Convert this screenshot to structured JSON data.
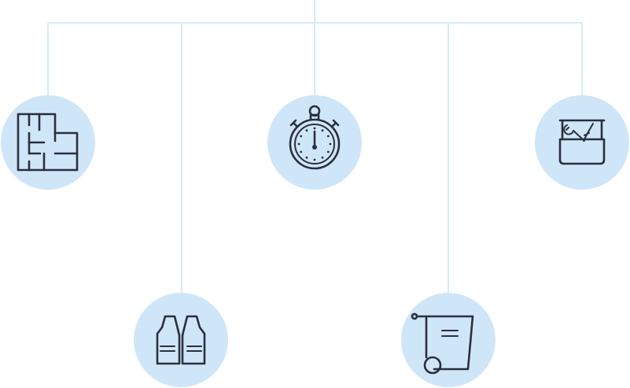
{
  "diagram": {
    "nodes": [
      {
        "id": "floor-plan",
        "icon": "floor-plan-icon"
      },
      {
        "id": "safety-vest",
        "icon": "safety-vest-icon"
      },
      {
        "id": "stopwatch",
        "icon": "stopwatch-icon"
      },
      {
        "id": "waste-bin",
        "icon": "wheelie-bin-icon"
      },
      {
        "id": "toolbox",
        "icon": "toolbox-icon"
      }
    ],
    "colors": {
      "connector": "#d6ebf6",
      "bubble": "#cfe6f9",
      "icon_stroke": "#2b2f3d",
      "background": "#ffffff"
    }
  }
}
